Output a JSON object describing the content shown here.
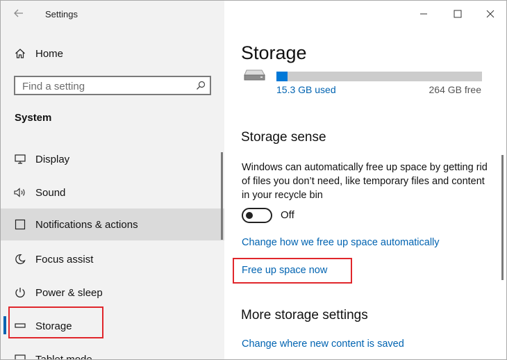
{
  "window": {
    "title": "Settings"
  },
  "sidebar": {
    "home_label": "Home",
    "search_placeholder": "Find a setting",
    "section_heading": "System",
    "items": [
      {
        "label": "Display",
        "icon": "monitor-icon"
      },
      {
        "label": "Sound",
        "icon": "speaker-icon"
      },
      {
        "label": "Notifications & actions",
        "icon": "notification-icon"
      },
      {
        "label": "Focus assist",
        "icon": "moon-icon"
      },
      {
        "label": "Power & sleep",
        "icon": "power-icon"
      },
      {
        "label": "Storage",
        "icon": "drive-icon",
        "selected": true
      },
      {
        "label": "Tablet mode",
        "icon": "tablet-icon"
      }
    ]
  },
  "content": {
    "title": "Storage",
    "drive": {
      "used": "15.3 GB used",
      "free": "264 GB free",
      "used_fraction": 0.055
    },
    "storage_sense": {
      "heading": "Storage sense",
      "description": "Windows can automatically free up space by getting rid of files you don’t need, like temporary files and content in your recycle bin",
      "toggle_state": "Off",
      "link_change": "Change how we free up space automatically",
      "link_free": "Free up space now"
    },
    "more": {
      "heading": "More storage settings",
      "link_change_location": "Change where new content is saved"
    }
  },
  "colors": {
    "accent": "#0063b1",
    "highlight": "#e0262b",
    "sidebar_bg": "#f2f2f2"
  }
}
